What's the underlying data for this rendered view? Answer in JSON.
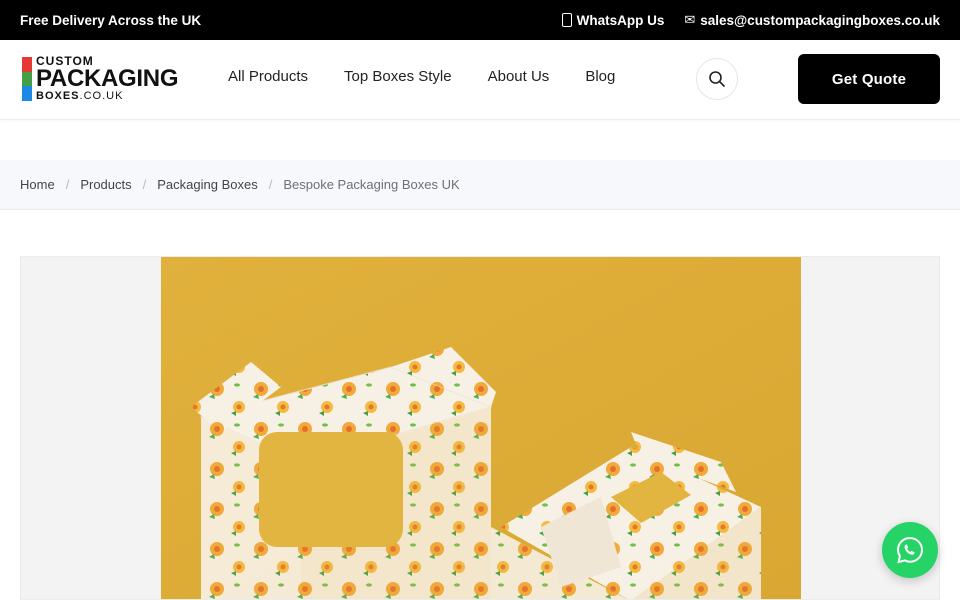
{
  "topbar": {
    "delivery_text": "Free Delivery Across the UK",
    "whatsapp_label": "WhatsApp Us",
    "email_label": "sales@custompackagingboxes.co.uk",
    "whatsapp_icon": "phone-icon",
    "email_icon": "mail-icon"
  },
  "logo": {
    "line1": "CUSTOM",
    "line2": "PACKAGING",
    "line3_bold": "BOXES",
    "line3_light": ".CO.UK",
    "bar_colors": [
      "#e53935",
      "#43a047",
      "#1e88e5"
    ]
  },
  "nav": {
    "items": [
      "All Products",
      "Top Boxes Style",
      "About Us",
      "Blog"
    ]
  },
  "header": {
    "search_icon": "search-icon",
    "quote_label": "Get Quote"
  },
  "breadcrumb": {
    "items": [
      "Home",
      "Products",
      "Packaging Boxes"
    ],
    "current": "Bespoke Packaging Boxes UK",
    "separator": "/"
  },
  "product": {
    "background_color": "#e2b33e",
    "box_color": "#f6efe3",
    "flower_color": "#f2a93b"
  },
  "floating": {
    "whatsapp_icon": "whatsapp-icon",
    "color": "#25d366"
  }
}
